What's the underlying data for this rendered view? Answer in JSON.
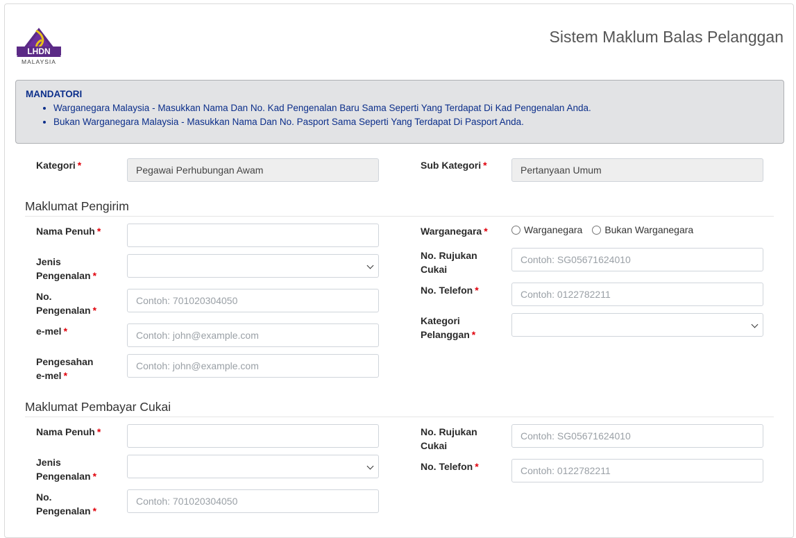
{
  "header": {
    "logo_text": "LHDN",
    "logo_subtext": "MALAYSIA",
    "app_title": "Sistem Maklum Balas Pelanggan"
  },
  "notice": {
    "title": "MANDATORI",
    "items": [
      "Warganegara Malaysia - Masukkan Nama Dan No. Kad Pengenalan Baru Sama Seperti Yang Terdapat Di Kad Pengenalan Anda.",
      "Bukan Warganegara Malaysia - Masukkan Nama Dan No. Pasport Sama Seperti Yang Terdapat Di Pasport Anda."
    ]
  },
  "category": {
    "label": "Kategori",
    "value": "Pegawai Perhubungan Awam",
    "sub_label": "Sub Kategori",
    "sub_value": "Pertanyaan Umum"
  },
  "sender": {
    "section_title": "Maklumat Pengirim",
    "nama_label": "Nama Penuh",
    "jenis_label_1": "Jenis",
    "jenis_label_2": "Pengenalan",
    "no_label_1": "No.",
    "no_label_2": "Pengenalan",
    "no_placeholder": "Contoh: 701020304050",
    "email_label": "e-mel",
    "email_placeholder": "Contoh: john@example.com",
    "confirm_label_1": "Pengesahan",
    "confirm_label_2": "e-mel",
    "confirm_placeholder": "Contoh: john@example.com",
    "warga_label": "Warganegara",
    "warga_opt1": "Warganegara",
    "warga_opt2": "Bukan Warganegara",
    "rujukan_label_1": "No. Rujukan",
    "rujukan_label_2": "Cukai",
    "rujukan_placeholder": "Contoh: SG05671624010",
    "telefon_label": "No. Telefon",
    "telefon_placeholder": "Contoh: 0122782211",
    "kategori_label_1": "Kategori",
    "kategori_label_2": "Pelanggan"
  },
  "payer": {
    "section_title": "Maklumat Pembayar Cukai",
    "nama_label": "Nama Penuh",
    "jenis_label_1": "Jenis",
    "jenis_label_2": "Pengenalan",
    "no_label_1": "No.",
    "no_label_2": "Pengenalan",
    "no_placeholder": "Contoh: 701020304050",
    "rujukan_label_1": "No. Rujukan",
    "rujukan_label_2": "Cukai",
    "rujukan_placeholder": "Contoh: SG05671624010",
    "telefon_label": "No. Telefon",
    "telefon_placeholder": "Contoh: 0122782211"
  },
  "required_marker": "*",
  "colors": {
    "accent": "#0b2e8a",
    "required": "#e0000b",
    "notice_bg": "#e2e3e5"
  }
}
